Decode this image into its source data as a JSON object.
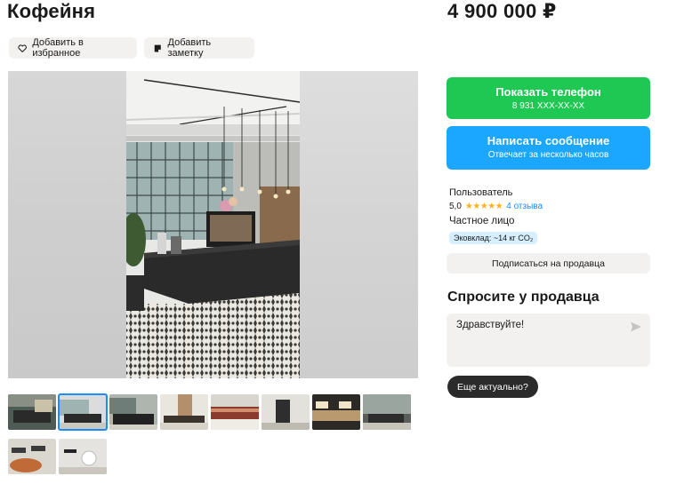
{
  "listing": {
    "title": "Кофейня",
    "price": "4 900 000 ₽"
  },
  "actions": {
    "favorite_label": "Добавить в избранное",
    "note_label": "Добавить заметку"
  },
  "gallery": {
    "thumbnail_count": 10,
    "selected_thumbnail": 2
  },
  "contact": {
    "phone_label": "Показать телефон",
    "phone_masked": "8 931 XXX-XX-XX",
    "message_label": "Написать сообщение",
    "message_sub": "Отвечает за несколько часов"
  },
  "seller": {
    "name": "Пользователь",
    "rating": "5,0",
    "stars": "★★★★★",
    "reviews": "4 отзыва",
    "type": "Частное лицо",
    "eco": "Эковклад: ~14 кг CO₂",
    "subscribe_label": "Подписаться на продавца"
  },
  "ask": {
    "title": "Спросите у продавца",
    "message_value": "Здравствуйте!",
    "quick_reply": "Еще актуально?"
  },
  "colors": {
    "phone_green": "#1fc753",
    "message_blue": "#1ba7ff",
    "link_blue": "#1a8cff",
    "star_orange": "#ffb21e"
  }
}
